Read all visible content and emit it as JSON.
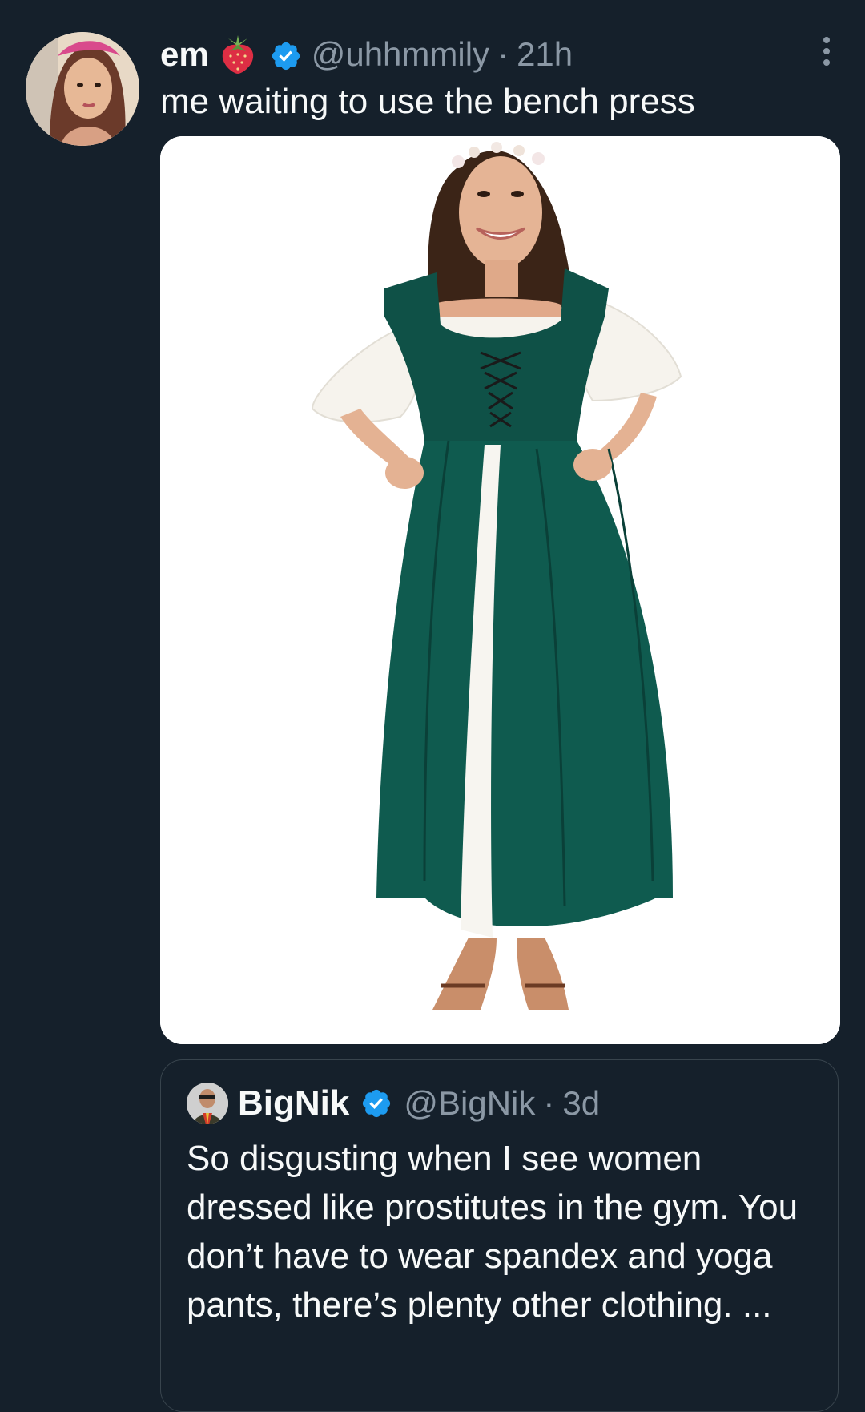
{
  "tweet": {
    "display_name": "em",
    "name_emoji": "strawberry-icon",
    "handle": "@uhhmmily",
    "separator": "·",
    "time": "21h",
    "text": "me waiting to use the bench press",
    "media_description_icon": "photo"
  },
  "quoted_tweet": {
    "display_name": "BigNik",
    "handle": "@BigNik",
    "separator": "·",
    "time": "3d",
    "text": "So disgusting when I see women dressed like prostitutes in the gym. You don’t have to wear spandex and yoga pants, there’s plenty other clothing. ..."
  },
  "colors": {
    "background": "#15202b",
    "text": "#f7f9f9",
    "secondary_text": "#8b98a5",
    "verified_blue": "#1d9bf0",
    "border": "#38444d"
  }
}
